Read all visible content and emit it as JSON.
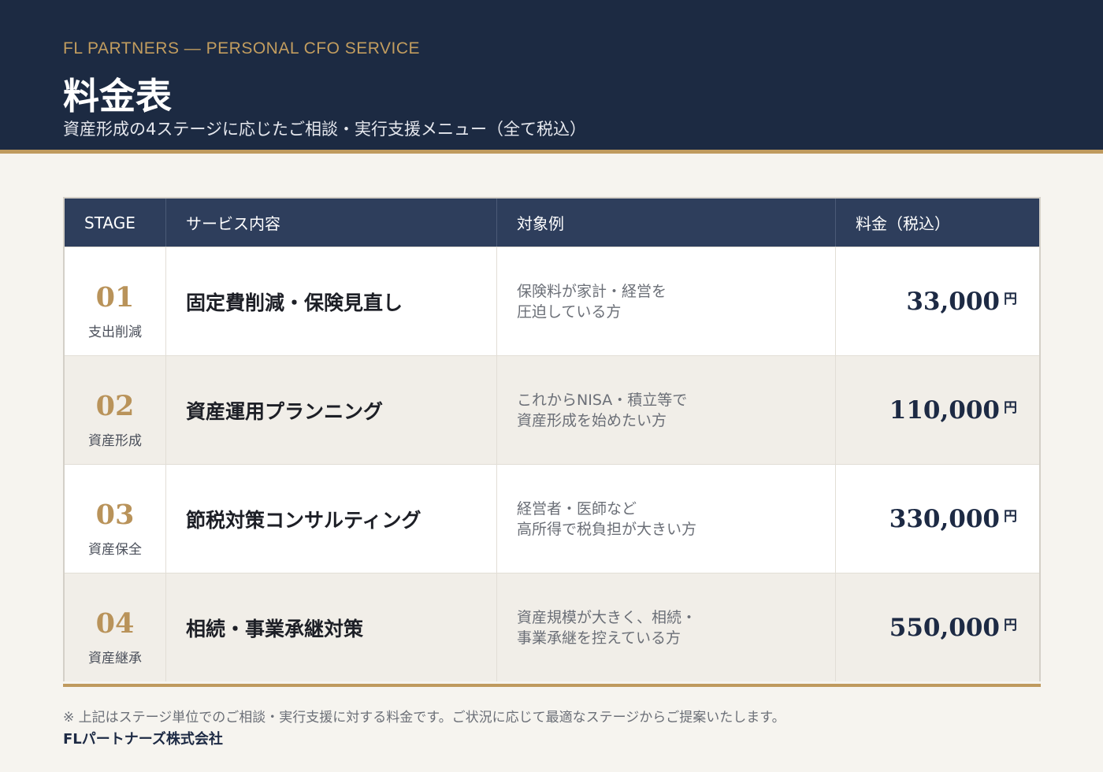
{
  "header": {
    "eyebrow": "FL PARTNERS — PERSONAL CFO SERVICE",
    "title": "料金表",
    "subtitle": "資産形成の4ステージに応じたご相談・実行支援メニュー（全て税込）"
  },
  "table": {
    "columns": [
      "STAGE",
      "サービス内容",
      "対象例",
      "料金（税込）"
    ],
    "rows": [
      {
        "stage_number": "01",
        "stage_label": "支出削減",
        "service": "固定費削減・保険見直し",
        "target_lines": [
          "保険料が家計・経営を",
          "圧迫している方"
        ],
        "price": "33,000",
        "unit": "円"
      },
      {
        "stage_number": "02",
        "stage_label": "資産形成",
        "service": "資産運用プランニング",
        "target_lines": [
          "これからNISA・積立等で",
          "資産形成を始めたい方"
        ],
        "price": "110,000",
        "unit": "円"
      },
      {
        "stage_number": "03",
        "stage_label": "資産保全",
        "service": "節税対策コンサルティング",
        "target_lines": [
          "経営者・医師など",
          "高所得で税負担が大きい方"
        ],
        "price": "330,000",
        "unit": "円"
      },
      {
        "stage_number": "04",
        "stage_label": "資産継承",
        "service": "相続・事業承継対策",
        "target_lines": [
          "資産規模が大きく、相続・",
          "事業承継を控えている方"
        ],
        "price": "550,000",
        "unit": "円"
      }
    ]
  },
  "footer": {
    "note": "※ 上記はステージ単位でのご相談・実行支援に対する料金です。ご状況に応じて最適なステージからご提案いたします。",
    "company": "FLパートナーズ株式会社"
  },
  "colors": {
    "navy": "#1c2a42",
    "header_row": "#2e3e5c",
    "gold": "#bf9a5e",
    "background": "#f6f4ef",
    "alt_row": "#f1eee8"
  }
}
